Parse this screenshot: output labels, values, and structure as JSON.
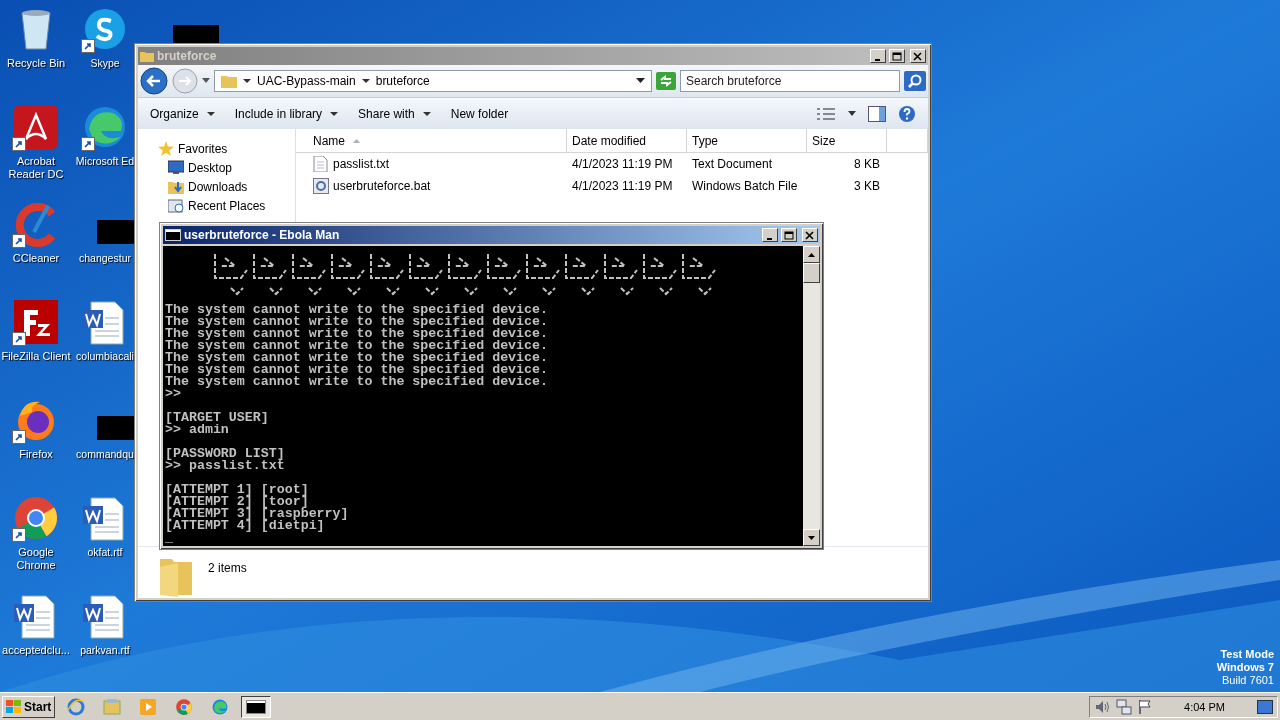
{
  "desktop_icons": [
    {
      "label": "Recycle Bin",
      "kind": "recycle",
      "shortcut": false
    },
    {
      "label": "Skype",
      "kind": "skype",
      "shortcut": true
    },
    {
      "kind": "redacted",
      "shortcut": false
    },
    {
      "label": "Acrobat Reader DC",
      "kind": "acrobat",
      "shortcut": true
    },
    {
      "label": "Microsoft Ed",
      "kind": "edge",
      "shortcut": true
    },
    {
      "label": "CCleaner",
      "kind": "ccleaner",
      "shortcut": true
    },
    {
      "label": "changestur",
      "kind": "redacted",
      "shortcut": false
    },
    {
      "label": "FileZilla Client",
      "kind": "filezilla",
      "shortcut": true
    },
    {
      "label": "columbiacali",
      "kind": "word",
      "shortcut": false
    },
    {
      "label": "Firefox",
      "kind": "firefox",
      "shortcut": true
    },
    {
      "label": "commandqu",
      "kind": "redacted",
      "shortcut": false
    },
    {
      "label": "Google Chrome",
      "kind": "chrome",
      "shortcut": true
    },
    {
      "label": "okfat.rtf",
      "kind": "word",
      "shortcut": false
    },
    {
      "label": "acceptedclu...",
      "kind": "word",
      "shortcut": false
    },
    {
      "label": "parkvan.rtf",
      "kind": "word",
      "shortcut": false
    }
  ],
  "explorer": {
    "title": "bruteforce",
    "active": false,
    "breadcrumbs": [
      "UAC-Bypass-main",
      "bruteforce"
    ],
    "search": {
      "placeholder": "Search bruteforce"
    },
    "toolbar": [
      {
        "label": "Organize",
        "dropdown": true
      },
      {
        "label": "Include in library",
        "dropdown": true
      },
      {
        "label": "Share with",
        "dropdown": true
      },
      {
        "label": "New folder",
        "dropdown": false
      }
    ],
    "nav": [
      {
        "label": "Favorites",
        "kind": "star",
        "children": [
          {
            "label": "Desktop",
            "kind": "desktop"
          },
          {
            "label": "Downloads",
            "kind": "downloads"
          },
          {
            "label": "Recent Places",
            "kind": "recent"
          }
        ]
      }
    ],
    "columns": [
      "Name",
      "Date modified",
      "Type",
      "Size"
    ],
    "files": [
      {
        "name": "passlist.txt",
        "kind": "text",
        "date": "4/1/2023 11:19 PM",
        "type": "Text Document",
        "size": "8 KB"
      },
      {
        "name": "userbruteforce.bat",
        "kind": "batch",
        "date": "4/1/2023 11:19 PM",
        "type": "Windows Batch File",
        "size": "3 KB"
      }
    ],
    "status": "2 items"
  },
  "console": {
    "title": "userbruteforce - Ebola Man",
    "active": true,
    "blocks": [
      [
        "The system cannot write to the specified device.",
        "The system cannot write to the specified device.",
        "The system cannot write to the specified device.",
        "The system cannot write to the specified device.",
        "The system cannot write to the specified device.",
        "The system cannot write to the specified device.",
        "The system cannot write to the specified device.",
        ">>"
      ],
      [
        "[TARGET USER]",
        ">> admin"
      ],
      [
        "[PASSWORD LIST]",
        ">> passlist.txt"
      ],
      [
        "[ATTEMPT 1] [root]",
        "[ATTEMPT 2] [toor]",
        "[ATTEMPT 3] [raspberry]",
        "[ATTEMPT 4] [dietpi]"
      ]
    ],
    "cursor": "_"
  },
  "taskbar": {
    "start": "Start",
    "buttons": [
      {
        "kind": "ie",
        "selected": false
      },
      {
        "kind": "explorer",
        "selected": false
      },
      {
        "kind": "media",
        "selected": false
      },
      {
        "kind": "chrome",
        "selected": false
      },
      {
        "kind": "edge",
        "selected": false
      },
      {
        "kind": "console",
        "selected": true
      }
    ],
    "time": "4:04 PM"
  },
  "watermark_info": [
    "Test Mode",
    "Windows 7",
    "Build 7601"
  ]
}
